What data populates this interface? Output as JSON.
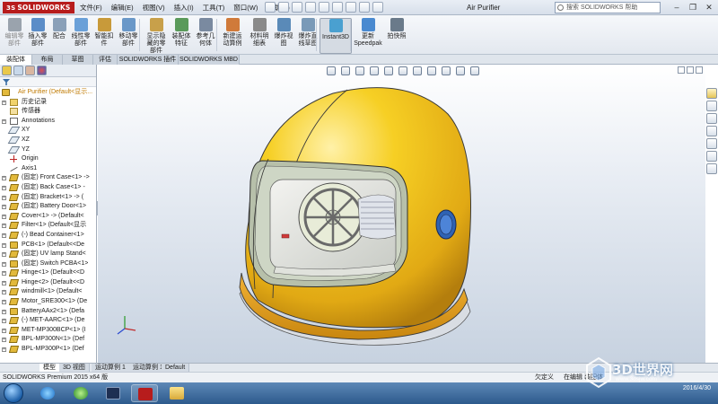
{
  "titlebar": {
    "logo": "SOLIDWORKS",
    "logo_mark": "3S",
    "menu": [
      "文件(F)",
      "编辑(E)",
      "视图(V)",
      "插入(I)",
      "工具(T)",
      "窗口(W)",
      "帮助(H)"
    ],
    "window_title": "Air Purifier",
    "search_placeholder": "搜索 SOLIDWORKS 帮助",
    "minimize": "–",
    "restore": "❐",
    "close": "✕"
  },
  "ribbon": {
    "buttons": [
      {
        "label": "编辑零\n部件",
        "color": "#9aa3ad",
        "disabled": true
      },
      {
        "label": "插入零\n部件",
        "color": "#5b8dc8"
      },
      {
        "label": "配合",
        "color": "#8aa0b8"
      },
      {
        "label": "线性零\n部件",
        "color": "#6aa0d8"
      },
      {
        "label": "智能扣\n件",
        "color": "#c89a3a"
      },
      {
        "label": "移动零\n部件",
        "color": "#6a98c8"
      },
      {
        "label": "显示隐\n藏的零\n部件",
        "color": "#c8a04a"
      },
      {
        "label": "装配体\n特征",
        "color": "#5a9a5a"
      },
      {
        "label": "参考几\n何体",
        "color": "#7a8aa0"
      },
      {
        "label": "新建运\n动算例",
        "color": "#d07a3a"
      },
      {
        "label": "材料明\n细表",
        "color": "#8a8a8a"
      },
      {
        "label": "爆炸视\n图",
        "color": "#5a8ab8"
      },
      {
        "label": "爆炸直\n线草图",
        "color": "#7a9ab8"
      },
      {
        "label": "Instant3D",
        "color": "#4aa0d0",
        "active": true
      },
      {
        "label": "更新\nSpeedpak",
        "color": "#4a8ad0"
      },
      {
        "label": "拍快照",
        "color": "#6a7a8a"
      }
    ]
  },
  "tabs": [
    "装配体",
    "布局",
    "草图",
    "评估",
    "SOLIDWORKS 插件",
    "SOLIDWORKS MBD"
  ],
  "tree": {
    "root": "Air Purifier  (Default<显示...",
    "items": [
      {
        "label": "历史记录",
        "icon": "folder"
      },
      {
        "label": "传感器",
        "icon": "sensor"
      },
      {
        "label": "Annotations",
        "icon": "note"
      },
      {
        "label": "XY",
        "icon": "plane"
      },
      {
        "label": "XZ",
        "icon": "plane"
      },
      {
        "label": "YZ",
        "icon": "plane"
      },
      {
        "label": "Origin",
        "icon": "origin"
      },
      {
        "label": "Axis1",
        "icon": "axis"
      },
      {
        "label": "(固定) Front Case<1> ->",
        "icon": "part"
      },
      {
        "label": "(固定) Back Case<1> -",
        "icon": "part"
      },
      {
        "label": "(固定) Bracket<1> -> (",
        "icon": "part"
      },
      {
        "label": "(固定) Battery Door<1>",
        "icon": "part"
      },
      {
        "label": "Cover<1> -> (Default<",
        "icon": "part"
      },
      {
        "label": "Filter<1> (Default<显示",
        "icon": "part"
      },
      {
        "label": "(-) Bead Container<1>",
        "icon": "part"
      },
      {
        "label": "PCB<1> (Default<<De",
        "icon": "asm"
      },
      {
        "label": "(固定) UV lamp Stand<",
        "icon": "part"
      },
      {
        "label": "(固定) Switch PCBA<1>",
        "icon": "asm"
      },
      {
        "label": "Hinge<1> (Default<<D",
        "icon": "part"
      },
      {
        "label": "Hinge<2> (Default<<D",
        "icon": "part"
      },
      {
        "label": "windmill<1> (Default<",
        "icon": "part"
      },
      {
        "label": "Motor_SRE300<1> (De",
        "icon": "part"
      },
      {
        "label": "BatteryAAx2<1> (Defa",
        "icon": "asm"
      },
      {
        "label": "(-) MET-AARC<1> (De",
        "icon": "part"
      },
      {
        "label": "MET-MP300BCP<1> (I",
        "icon": "part"
      },
      {
        "label": "BPL-MP300N<1> (Def",
        "icon": "part"
      },
      {
        "label": "BPL-MP300P<1> (Def",
        "icon": "part"
      }
    ]
  },
  "bottom_tabs": [
    "模型",
    "3D 视图",
    "运动算例 1",
    "运动算例 1",
    "Default"
  ],
  "status": {
    "left": "SOLIDWORKS Premium 2015 x64 版",
    "state": "欠定义",
    "mode": "在编辑 装配体"
  },
  "taskbar": {
    "time": "",
    "date": "2016/4/30"
  },
  "watermark": {
    "text": "3D世界网",
    "sub": "www.3dsjw.com"
  },
  "colors": {
    "helmet_yellow": "#f3c419",
    "helmet_rim": "#e8a81c",
    "visor": "#c9d6c7",
    "tree_root": "#c07a00"
  }
}
